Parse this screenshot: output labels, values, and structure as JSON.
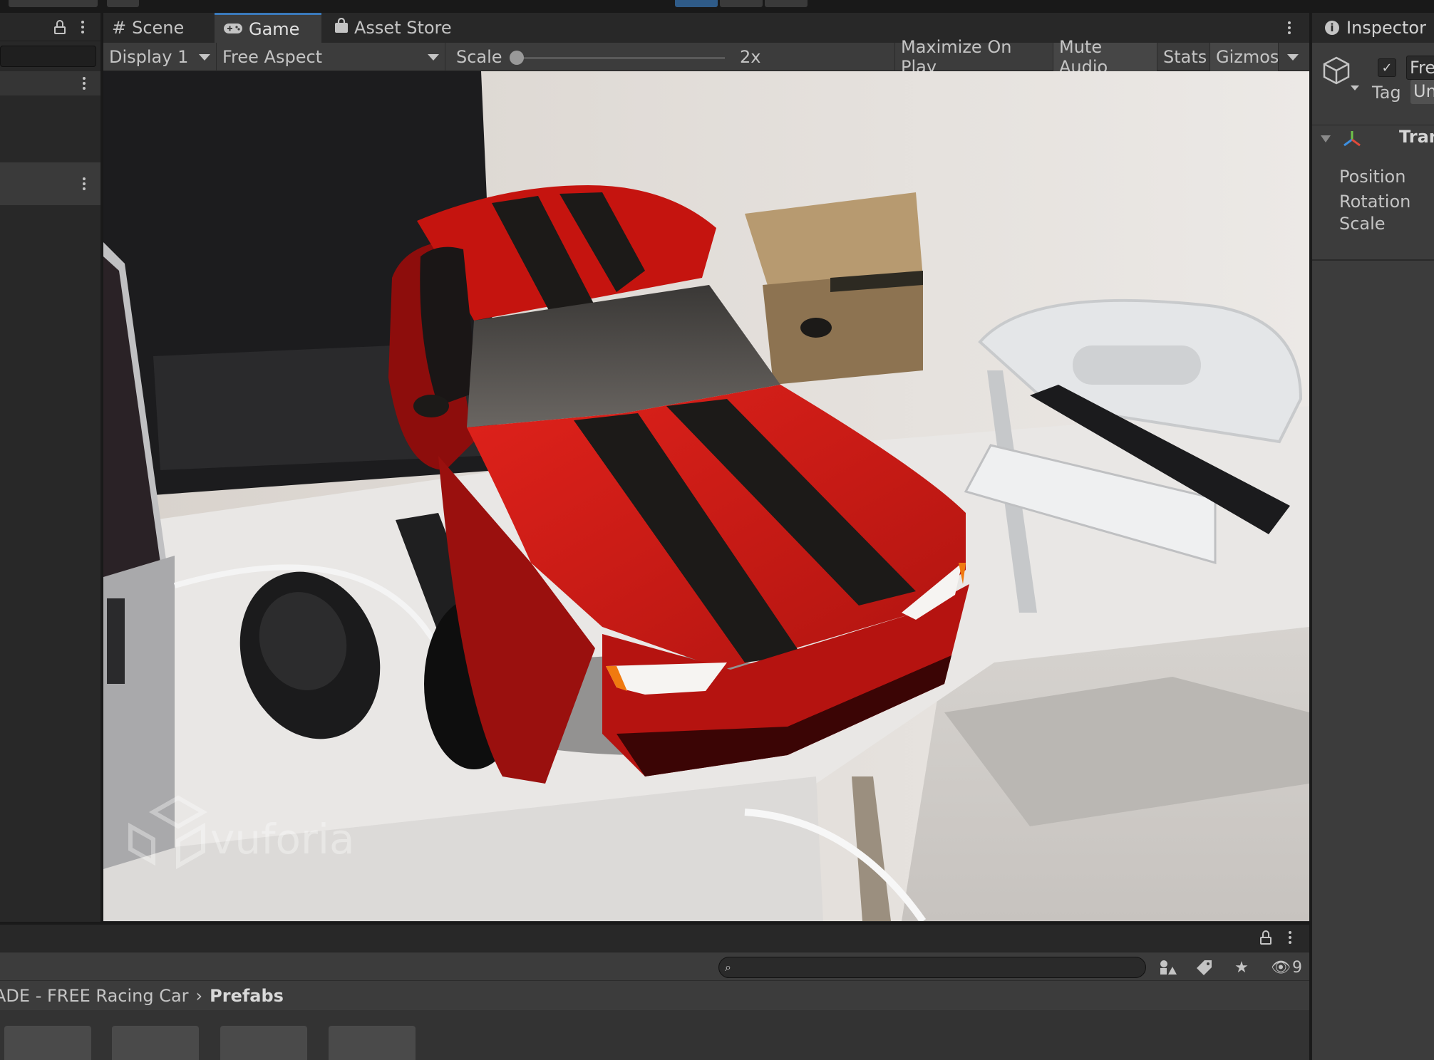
{
  "game_view": {
    "tabs": [
      {
        "label": "Scene",
        "icon": "scene-grid-icon"
      },
      {
        "label": "Game",
        "icon": "gamepad-icon"
      },
      {
        "label": "Asset Store",
        "icon": "shopping-bag-icon"
      }
    ],
    "toolbar": {
      "display": "Display 1",
      "aspect": "Free Aspect",
      "scale_label": "Scale",
      "scale_value": "2x",
      "scale_fraction": 0.0,
      "maximize_on_play": "Maximize On Play",
      "mute_audio": "Mute Audio",
      "stats": "Stats",
      "gizmos": "Gizmos"
    },
    "watermark": "vuforia"
  },
  "inspector": {
    "title": "Inspector",
    "object_name": "Fre",
    "tag_label": "Tag",
    "tag_value": "Un",
    "component_title": "Tran",
    "fields": [
      "Position",
      "Rotation",
      "Scale"
    ]
  },
  "project": {
    "breadcrumb": [
      "ADE - FREE Racing Car",
      "Prefabs"
    ],
    "hidden_count": "9"
  },
  "colors": {
    "accent_tab": "#3a79bb",
    "car_red": "#d81a16",
    "stripe": "#1c1a18"
  }
}
